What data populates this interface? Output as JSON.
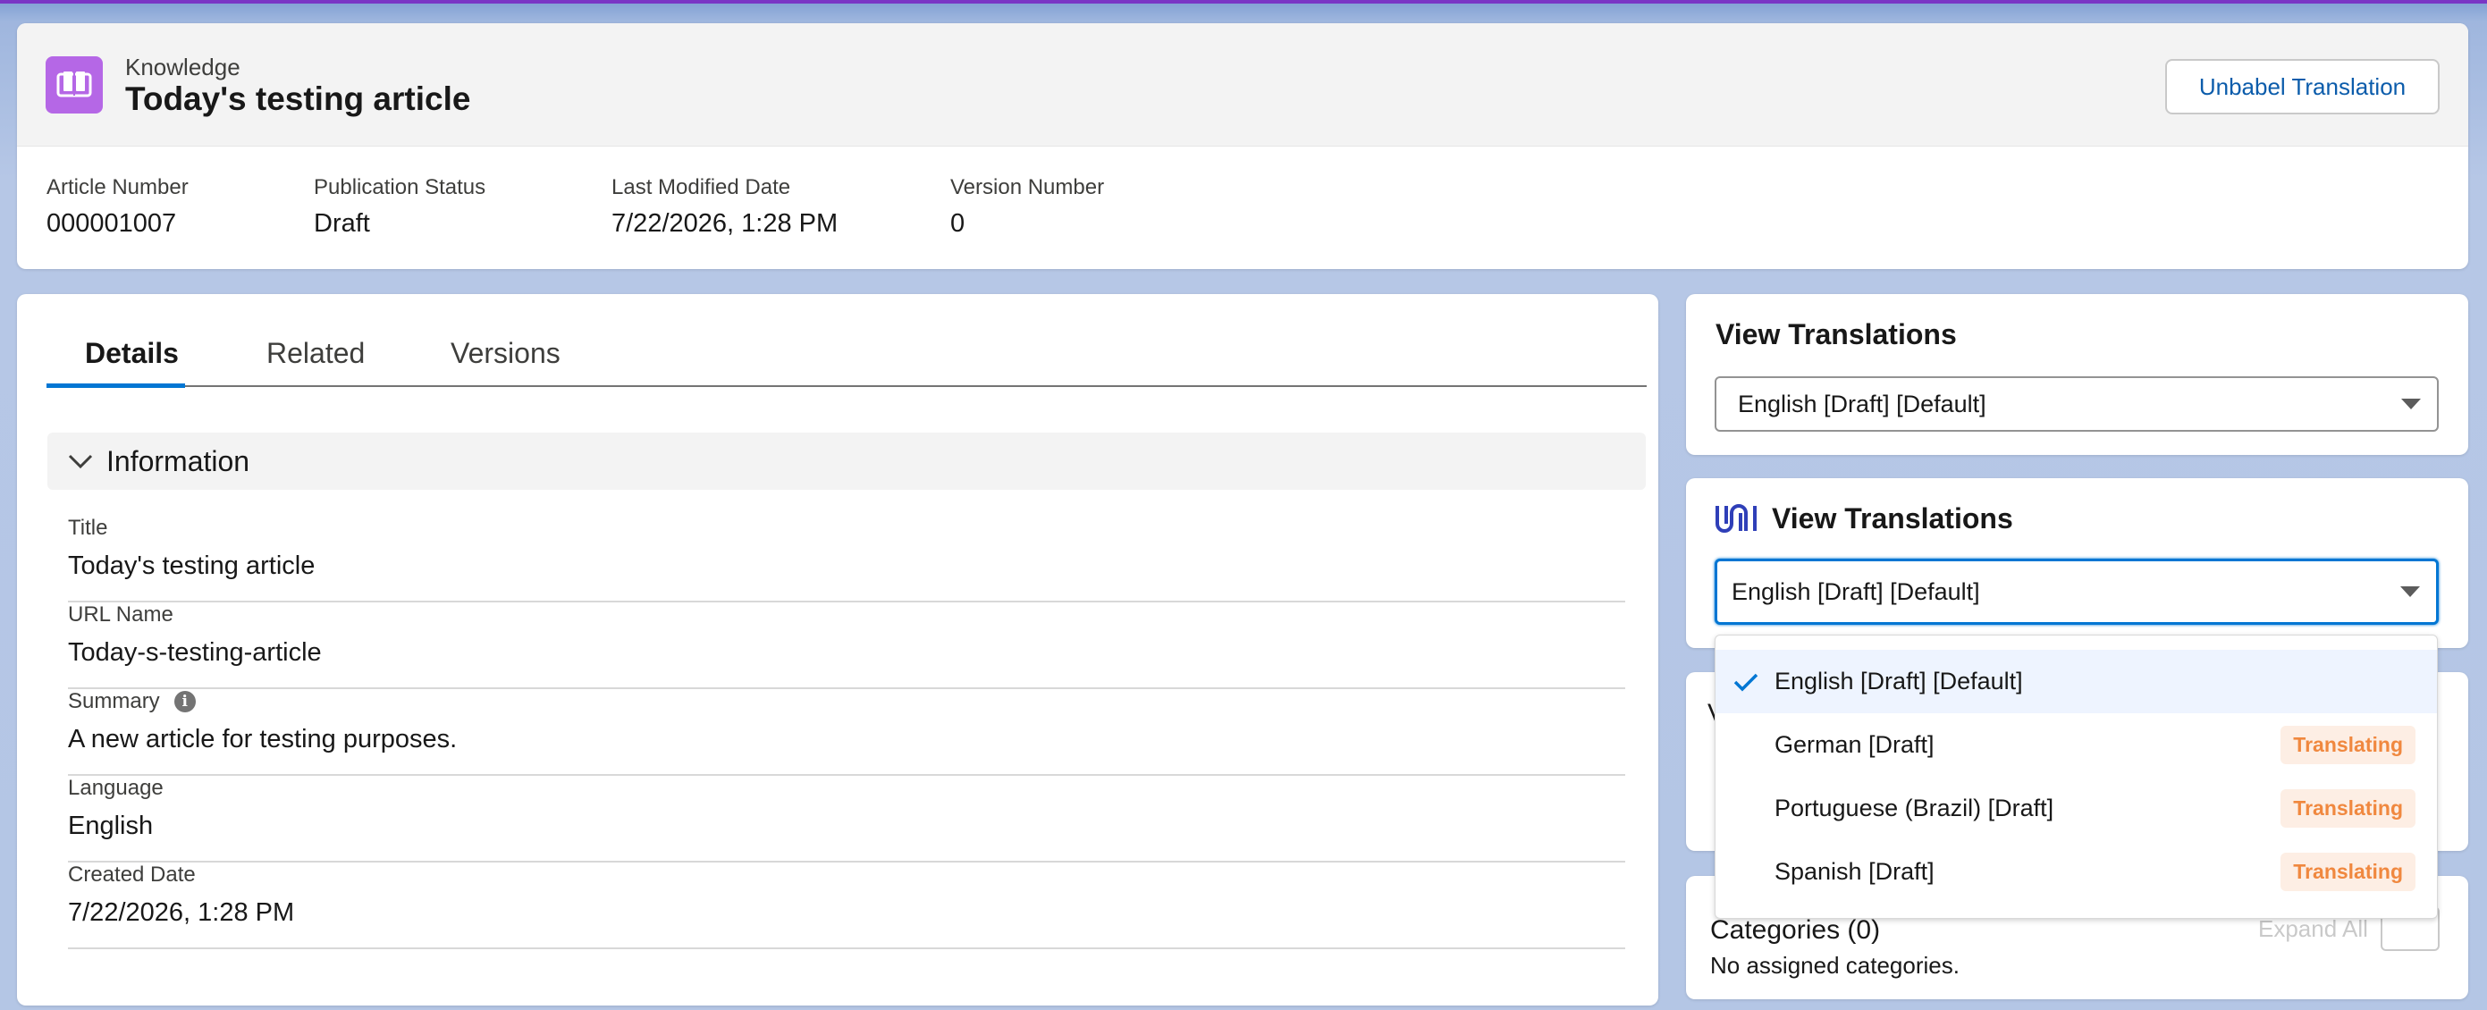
{
  "colors": {
    "accent": "#0176d3",
    "knowledge_icon": "#b567e6",
    "badge_text": "#f0883f",
    "badge_bg": "#fdeee4"
  },
  "header": {
    "object_type": "Knowledge",
    "title": "Today's testing article",
    "action_button": "Unbabel Translation",
    "fields": [
      {
        "label": "Article Number",
        "value": "000001007"
      },
      {
        "label": "Publication Status",
        "value": "Draft"
      },
      {
        "label": "Last Modified Date",
        "value": "7/22/2026, 1:28 PM"
      },
      {
        "label": "Version Number",
        "value": "0"
      }
    ]
  },
  "tabs": [
    {
      "label": "Details",
      "active": true
    },
    {
      "label": "Related",
      "active": false
    },
    {
      "label": "Versions",
      "active": false
    }
  ],
  "section": {
    "title": "Information",
    "fields": [
      {
        "label": "Title",
        "value": "Today's testing article"
      },
      {
        "label": "URL Name",
        "value": "Today-s-testing-article"
      },
      {
        "label": "Summary",
        "value": "A new article for testing purposes.",
        "info_icon": "info-icon"
      },
      {
        "label": "Language",
        "value": "English"
      },
      {
        "label": "Created Date",
        "value": "7/22/2026, 1:28 PM"
      }
    ]
  },
  "view_translations_1": {
    "title": "View Translations",
    "selected": "English [Draft] [Default]"
  },
  "view_translations_2": {
    "title": "View Translations",
    "icon": "unbabel-logo-icon",
    "selected": "English [Draft] [Default]",
    "options": [
      {
        "label": "English [Draft] [Default]",
        "selected": true,
        "badge": ""
      },
      {
        "label": "German [Draft]",
        "selected": false,
        "badge": "Translating"
      },
      {
        "label": "Portuguese (Brazil) [Draft]",
        "selected": false,
        "badge": "Translating"
      },
      {
        "label": "Spanish [Draft]",
        "selected": false,
        "badge": "Translating"
      }
    ]
  },
  "categories": {
    "title": "Categories (0)",
    "expand_label": "Expand All",
    "empty_text": "No assigned categories."
  },
  "hidden_card_fragment": "V"
}
